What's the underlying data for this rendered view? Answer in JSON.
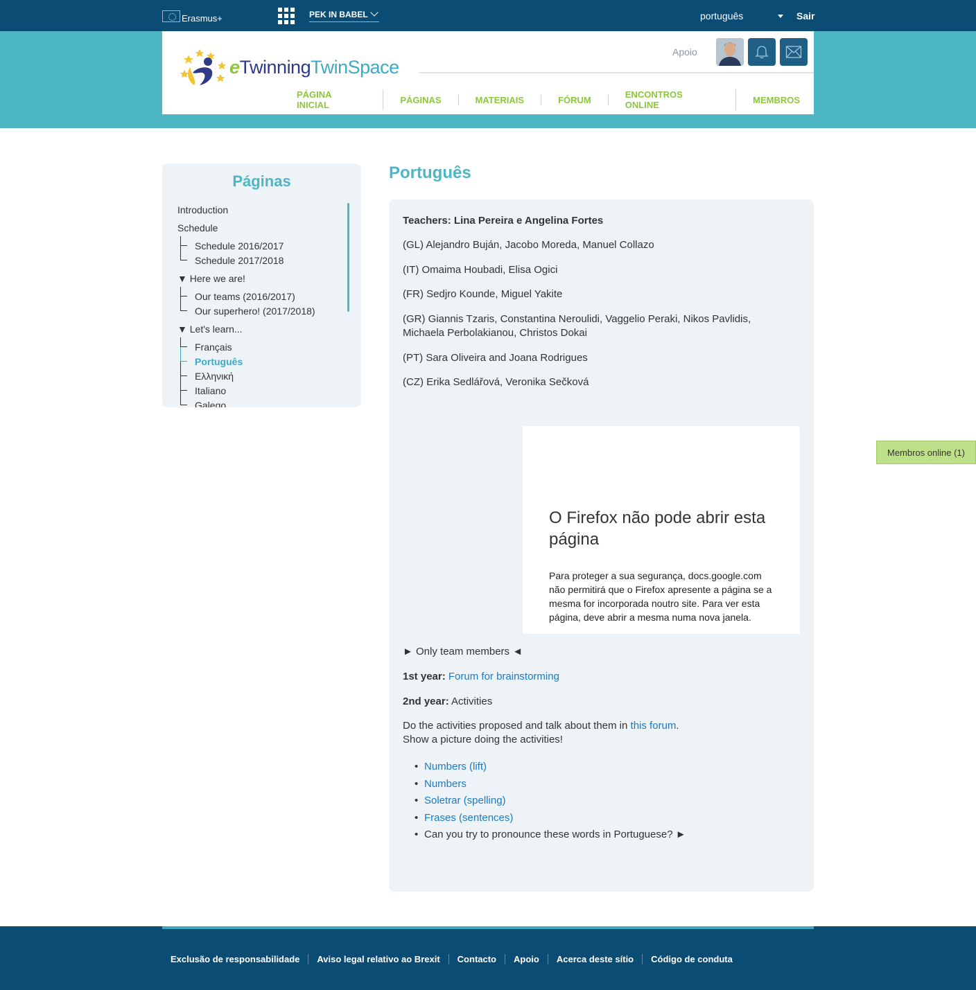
{
  "topbar": {
    "eu_label": "Erasmus+",
    "project": "PEK IN BABEL",
    "language": "português",
    "logout": "Sair"
  },
  "header": {
    "logo_e": "e",
    "logo_twinning": "Twinning",
    "logo_twinspace": "TwinSpace",
    "support": "Apoio",
    "nav": [
      "PÁGINA INICIAL",
      "PÁGINAS",
      "MATERIAIS",
      "FÓRUM",
      "ENCONTROS ONLINE",
      "MEMBROS"
    ]
  },
  "sidebar": {
    "title": "Páginas",
    "items": [
      {
        "label": "Introduction"
      },
      {
        "label": "Schedule"
      },
      {
        "label": "Schedule 2016/2017"
      },
      {
        "label": "Schedule 2017/2018"
      },
      {
        "label": "▼ Here we are!"
      },
      {
        "label": "Our teams (2016/2017)"
      },
      {
        "label": "Our superhero! (2017/2018)"
      },
      {
        "label": "▼ Let's learn..."
      },
      {
        "label": "Français"
      },
      {
        "label": "Português"
      },
      {
        "label": "Ελληνική"
      },
      {
        "label": "Italiano"
      },
      {
        "label": "Galego"
      }
    ]
  },
  "main": {
    "title": "Português",
    "teachers": "Teachers: Lina Pereira e Angelina Fortes",
    "lines": [
      "(GL) Alejandro Buján, Jacobo Moreda, Manuel Collazo",
      "(IT) Omaima Houbadi, Elisa Ogici",
      "(FR) Sedjro Kounde, Miguel Yakite",
      "(GR) Giannis Tzaris, Constantina Neroulidi, Vaggelio Peraki, Nikos Pavlidis,",
      "Michaela Perbolakianou, Christos Dokai",
      "(PT) Sara Oliveira and Joana Rodrigues",
      "(CZ) Erika Sedlářová, Veronika Sečková"
    ],
    "iframe": {
      "title": "O Firefox não pode abrir esta página",
      "body": "Para proteger a sua segurança, docs.google.com não permitirá que o Firefox apresente a página se a mesma for incorporada noutro site. Para ver esta página, deve abrir a mesma numa nova janela."
    },
    "only_members": "► Only team members ◄",
    "first_year_label": "1st year:",
    "first_year_link": "Forum for brainstorming",
    "second_year_label": "2nd year:",
    "second_year_text": "Activities",
    "activities_text": "Do the activities proposed and talk about them in",
    "activities_link": "this forum",
    "activities_end": ".",
    "show_picture": "Show a picture doing the activities!",
    "bullets": [
      "Numbers (lift)",
      "Numbers",
      "Soletrar (spelling)",
      "Frases (sentences)"
    ],
    "last_bullet": "Can you try to pronounce these words in Portuguese? ►"
  },
  "online_members": "Membros online (1)",
  "footer": {
    "links": [
      "Exclusão de responsabilidade",
      "Aviso legal relativo ao Brexit",
      "Contacto",
      "Apoio",
      "Acerca deste sítio",
      "Código de conduta"
    ]
  }
}
